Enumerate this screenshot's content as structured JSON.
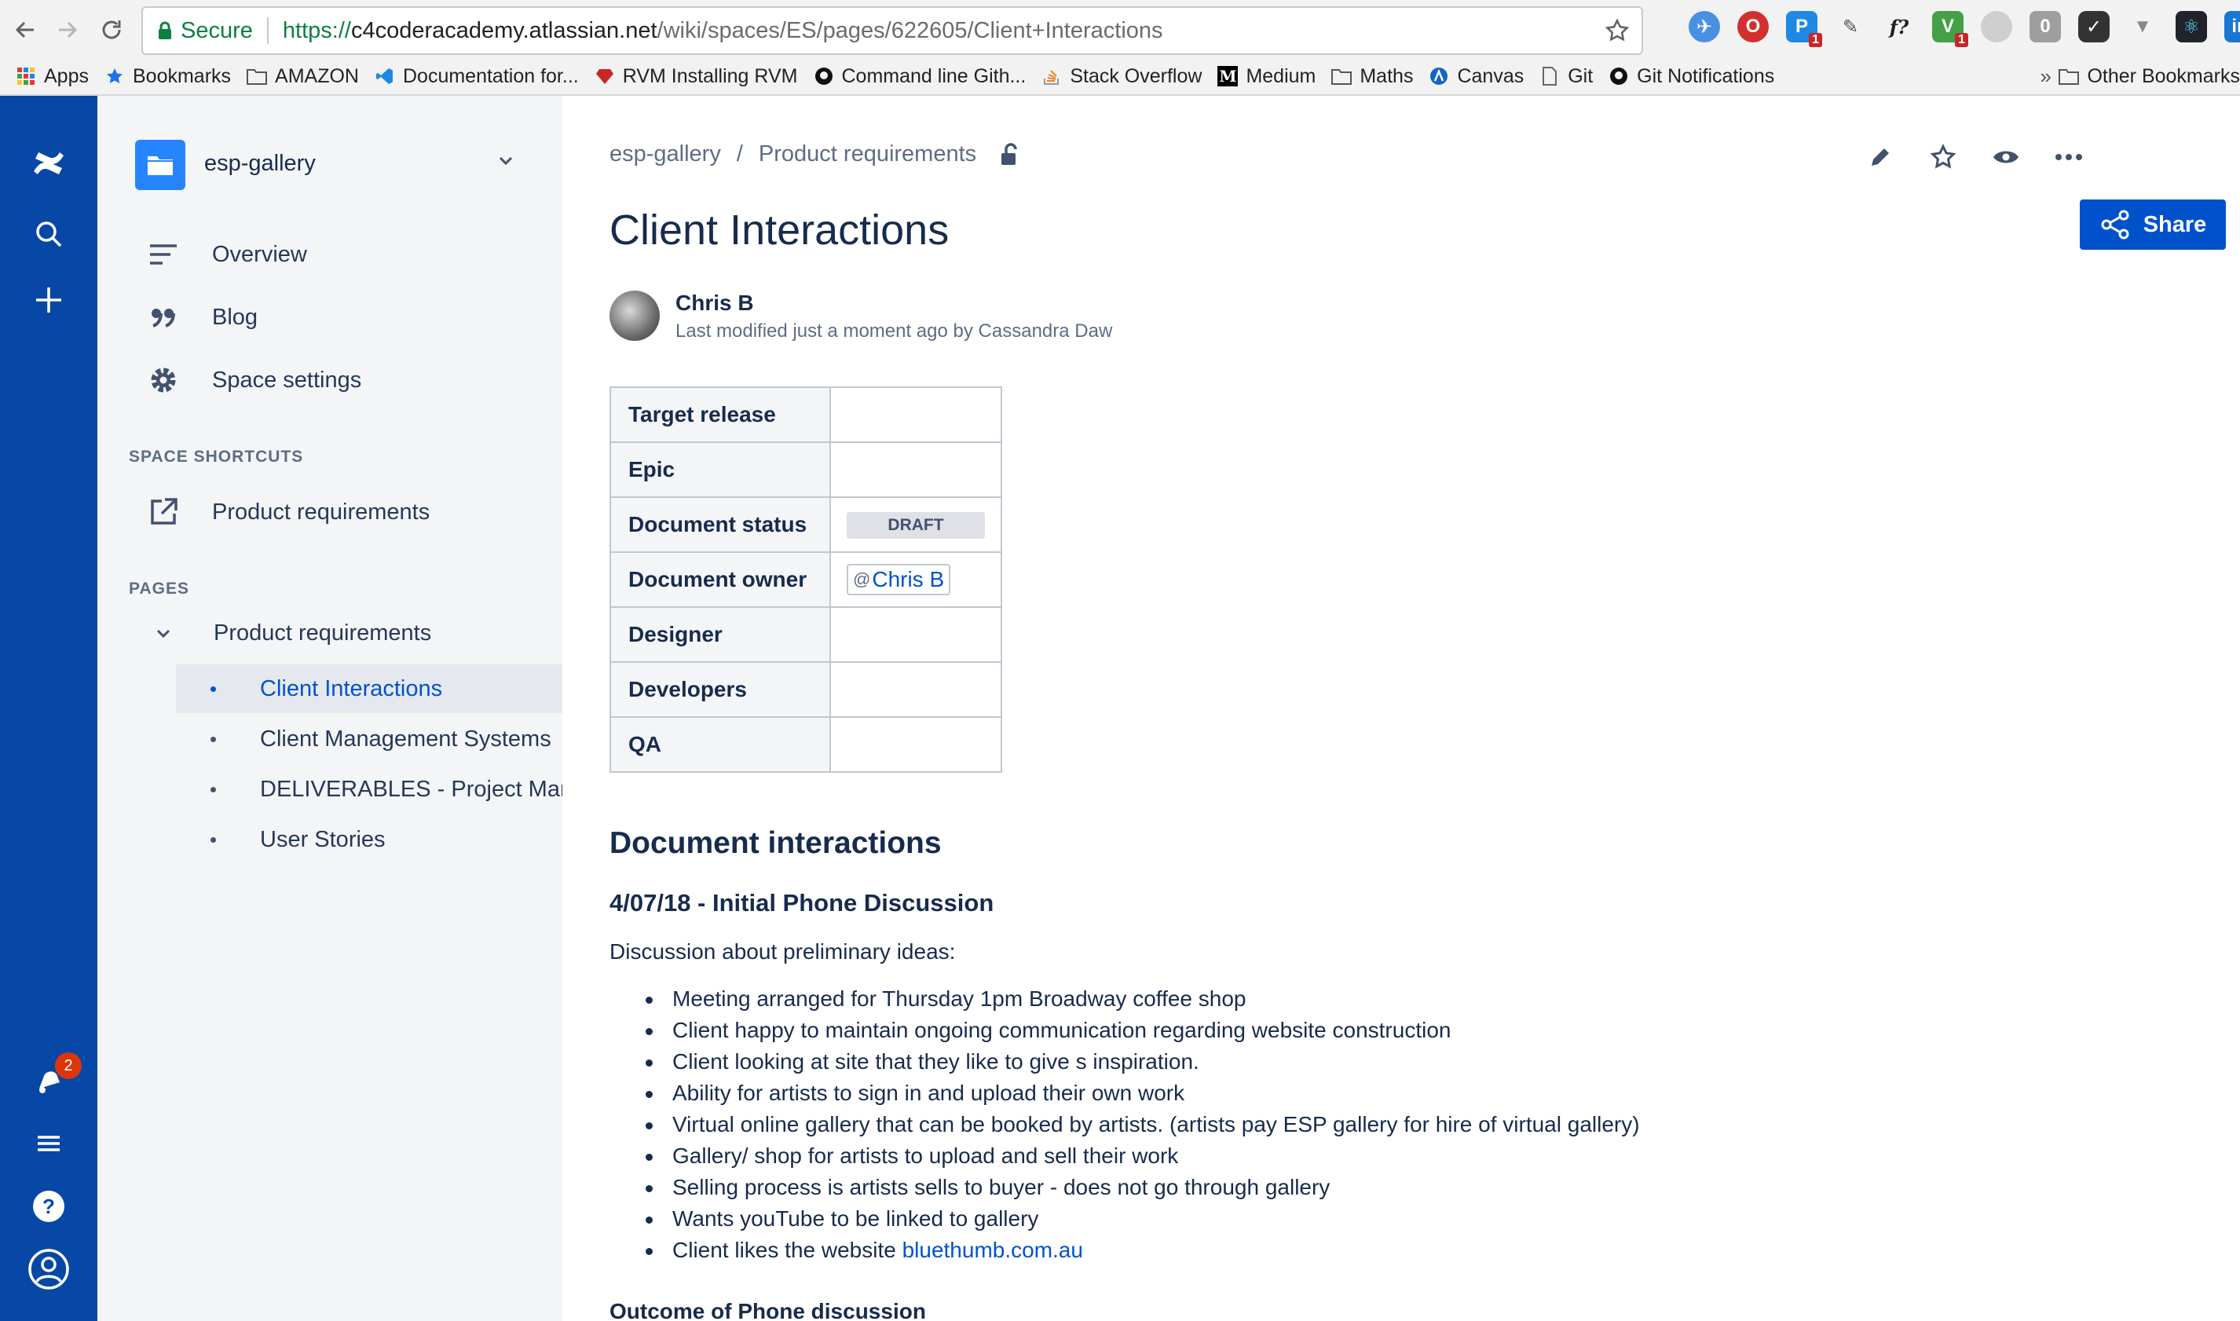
{
  "browser": {
    "secure_label": "Secure",
    "url_scheme": "https://",
    "url_host": "c4coderacademy.atlassian.net",
    "url_path": "/wiki/spaces/ES/pages/622605/Client+Interactions",
    "extension_badges": [
      "1",
      "1",
      "2"
    ],
    "bookmarks": [
      {
        "label": "Apps",
        "icon": "apps-grid-icon"
      },
      {
        "label": "Bookmarks",
        "icon": "star-icon"
      },
      {
        "label": "AMAZON",
        "icon": "folder-icon"
      },
      {
        "label": "Documentation for...",
        "icon": "vscode-icon"
      },
      {
        "label": "RVM Installing RVM",
        "icon": "ruby-icon"
      },
      {
        "label": "Command line Gith...",
        "icon": "github-icon"
      },
      {
        "label": "Stack Overflow",
        "icon": "stackoverflow-icon"
      },
      {
        "label": "Medium",
        "icon": "medium-icon"
      },
      {
        "label": "Maths",
        "icon": "folder-icon"
      },
      {
        "label": "Canvas",
        "icon": "canvas-icon"
      },
      {
        "label": "Git",
        "icon": "page-icon"
      },
      {
        "label": "Git Notifications",
        "icon": "github-icon"
      }
    ],
    "more_label": "»",
    "other_bookmarks": "Other Bookmarks"
  },
  "global_nav": {
    "notification_count": "2",
    "colors": {
      "background": "#0747a6",
      "badge": "#de350b"
    }
  },
  "sidebar": {
    "space_name": "esp-gallery",
    "nav": [
      {
        "label": "Overview",
        "icon": "overview-lines-icon"
      },
      {
        "label": "Blog",
        "icon": "quote-icon"
      },
      {
        "label": "Space settings",
        "icon": "gear-icon"
      }
    ],
    "shortcuts_heading": "SPACE SHORTCUTS",
    "shortcut": {
      "label": "Product requirements",
      "icon": "external-link-icon"
    },
    "pages_heading": "PAGES",
    "tree_parent": "Product requirements",
    "tree_items": [
      {
        "label": "Client Interactions",
        "active": true
      },
      {
        "label": "Client Management Systems",
        "active": false
      },
      {
        "label": "DELIVERABLES - Project Management",
        "active": false
      },
      {
        "label": "User Stories",
        "active": false
      }
    ]
  },
  "page": {
    "breadcrumb": [
      "esp-gallery",
      "Product requirements"
    ],
    "breadcrumb_separator": "/",
    "share_label": "Share",
    "title": "Client Interactions",
    "author": "Chris B",
    "byline": "Last modified just a moment ago by Cassandra Daw",
    "properties": [
      {
        "key": "Target release",
        "value": ""
      },
      {
        "key": "Epic",
        "value": ""
      },
      {
        "key": "Document status",
        "value": "DRAFT"
      },
      {
        "key": "Document owner",
        "value": "Chris B"
      },
      {
        "key": "Designer",
        "value": ""
      },
      {
        "key": "Developers",
        "value": ""
      },
      {
        "key": "QA",
        "value": ""
      }
    ],
    "mention_prefix": "@",
    "section_heading": "Document interactions",
    "entry_heading": "4/07/18 - Initial Phone Discussion",
    "entry_intro": "Discussion about preliminary ideas:",
    "bullets": [
      "Meeting arranged for Thursday 1pm Broadway coffee shop",
      "Client happy to maintain ongoing communication regarding website construction",
      "Client looking at site that they like to give s inspiration.",
      "Ability for artists to sign in and upload their own work",
      "Virtual online gallery that can be booked by artists. (artists pay ESP gallery for hire of virtual gallery)",
      "Gallery/ shop  for artists to upload and sell their work",
      "Selling process is artists sells to buyer -  does not go through gallery",
      "Wants youTube to be linked to gallery"
    ],
    "last_bullet_prefix": "Client likes the website ",
    "last_bullet_link": "bluethumb.com.au",
    "outcome_heading": "Outcome of Phone discussion",
    "colors": {
      "primary": "#0052cc",
      "text": "#172b4d",
      "muted": "#5e6c84"
    }
  }
}
